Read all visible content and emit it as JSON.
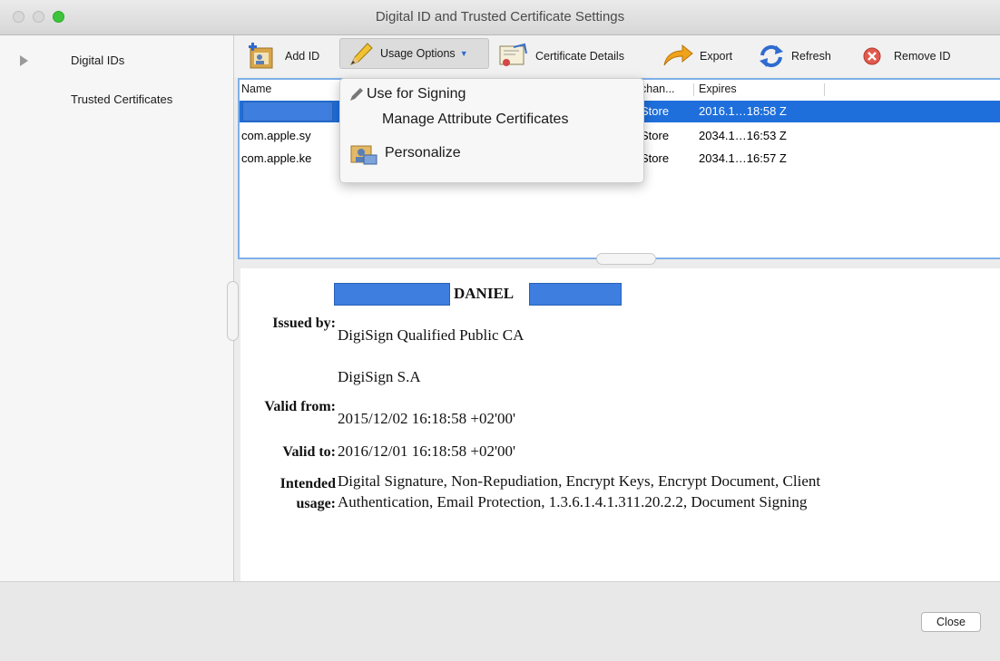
{
  "window": {
    "title": "Digital ID and Trusted Certificate Settings"
  },
  "sidebar": {
    "items": [
      {
        "label": "Digital IDs"
      },
      {
        "label": "Trusted Certificates"
      }
    ]
  },
  "toolbar": {
    "add_id": "Add ID",
    "usage_options": "Usage Options",
    "certificate_details": "Certificate Details",
    "export": "Export",
    "refresh": "Refresh",
    "remove_id": "Remove ID"
  },
  "usage_menu": {
    "use_for_signing": "Use for Signing",
    "manage_attribute_certificates": "Manage Attribute Certificates",
    "personalize": "Personalize"
  },
  "id_list": {
    "columns": {
      "name": "Name",
      "keychain": "chan...",
      "expires": "Expires"
    },
    "rows": [
      {
        "name": "",
        "keychain": "Store",
        "expires": "2016.1…18:58 Z",
        "selected": true
      },
      {
        "name": "com.apple.sy",
        "keychain": "Store",
        "expires": "2034.1…16:53 Z",
        "selected": false
      },
      {
        "name": "com.apple.ke",
        "keychain": "Store",
        "expires": "2034.1…16:57 Z",
        "selected": false
      }
    ]
  },
  "details": {
    "subject_name": "DANIEL",
    "issued_by_label": "Issued by:",
    "issued_by_line1": "DigiSign Qualified Public CA",
    "issued_by_line2": "DigiSign S.A",
    "valid_from_label": "Valid from:",
    "valid_from": "2015/12/02 16:18:58 +02'00'",
    "valid_to_label": "Valid to:",
    "valid_to": "2016/12/01 16:18:58 +02'00'",
    "intended_usage_label": "Intended usage:",
    "intended_usage_line1": "Digital Signature, Non-Repudiation, Encrypt Keys, Encrypt Document, Client",
    "intended_usage_line2": "Authentication, Email Protection, 1.3.6.1.4.1.311.20.2.2, Document Signing"
  },
  "footer": {
    "close": "Close"
  },
  "colors": {
    "selection": "#1e6fdb",
    "redaction": "#3d7ede",
    "focus_ring": "#7fb0e8"
  }
}
